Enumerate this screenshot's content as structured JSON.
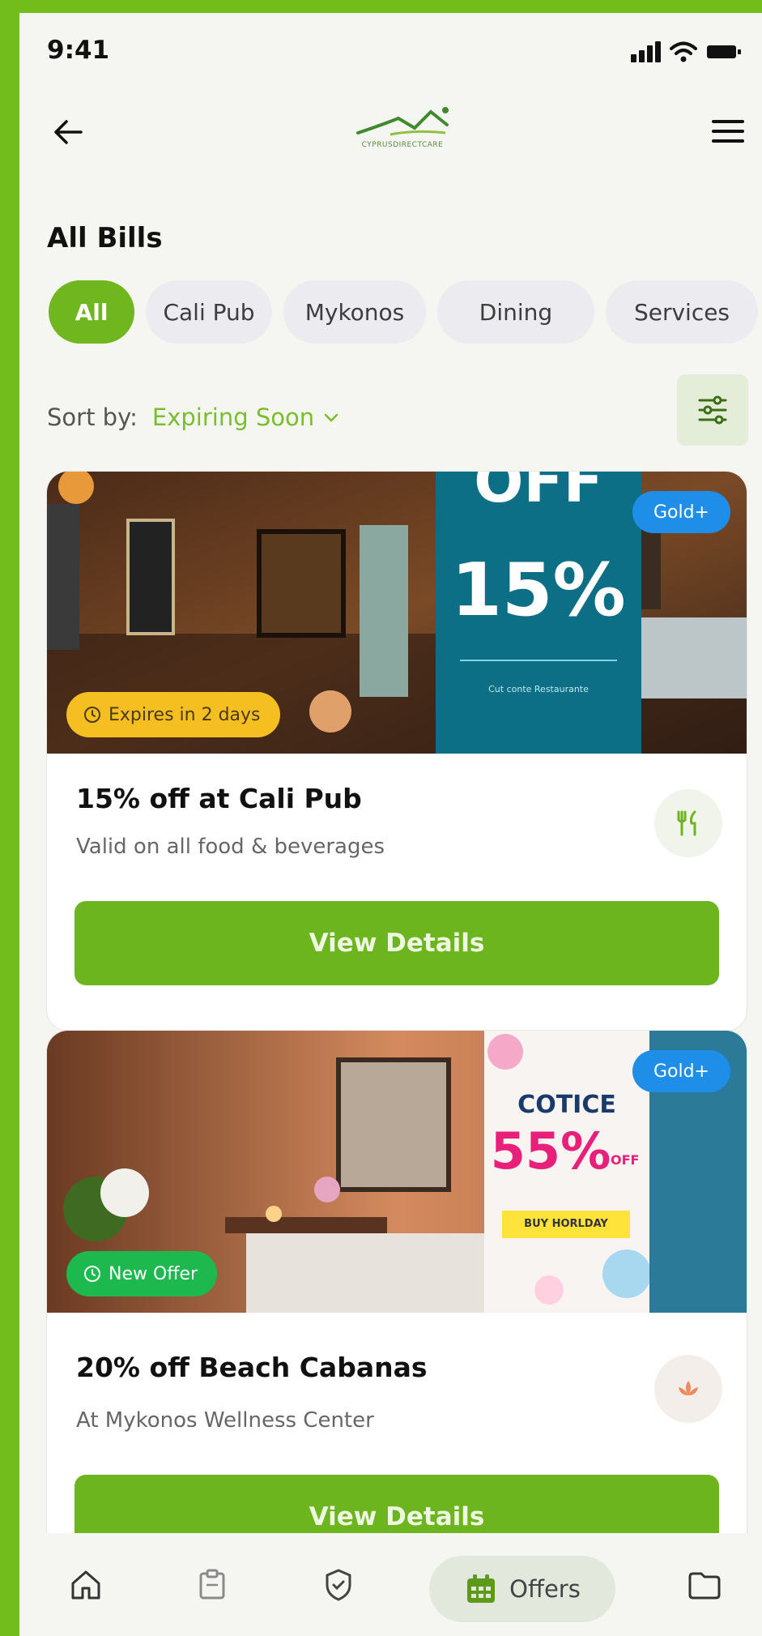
{
  "status_bar": {
    "time": "9:41"
  },
  "header": {
    "logo_text": "CYPRUSDIRECTCARE",
    "page_title": "All Bills"
  },
  "chips": [
    "All",
    "Cali Pub",
    "Mykonos",
    "Dining",
    "Services"
  ],
  "sort": {
    "label": "Sort by:",
    "value": "Expiring Soon"
  },
  "cards": [
    {
      "image_banner": {
        "top_text": "OFF",
        "big_text": "15%",
        "small_text": "Cut conte Restaurante"
      },
      "tier_badge": "Gold+",
      "status_pill": "Expires in 2 days",
      "title": "15% off at Cali Pub",
      "subtitle": "Valid on all food & beverages",
      "button": "View Details",
      "icon": "fork-knife-icon"
    },
    {
      "image_banner": {
        "top_text": "COTICE",
        "big_text": "55%",
        "off_text": "OFF",
        "tag_text": "BUY HORLDAY"
      },
      "tier_badge": "Gold+",
      "status_pill": "New Offer",
      "title": "20% off Beach Cabanas",
      "subtitle": "At Mykonos Wellness Center",
      "button": "View Details",
      "icon": "lotus-icon"
    }
  ],
  "bottom_nav": {
    "offers_label": "Offers"
  },
  "colors": {
    "accent": "#6db51e",
    "gold_badge": "#1f8ee8",
    "expire_pill": "#f5bf21",
    "new_pill": "#1db94f"
  }
}
